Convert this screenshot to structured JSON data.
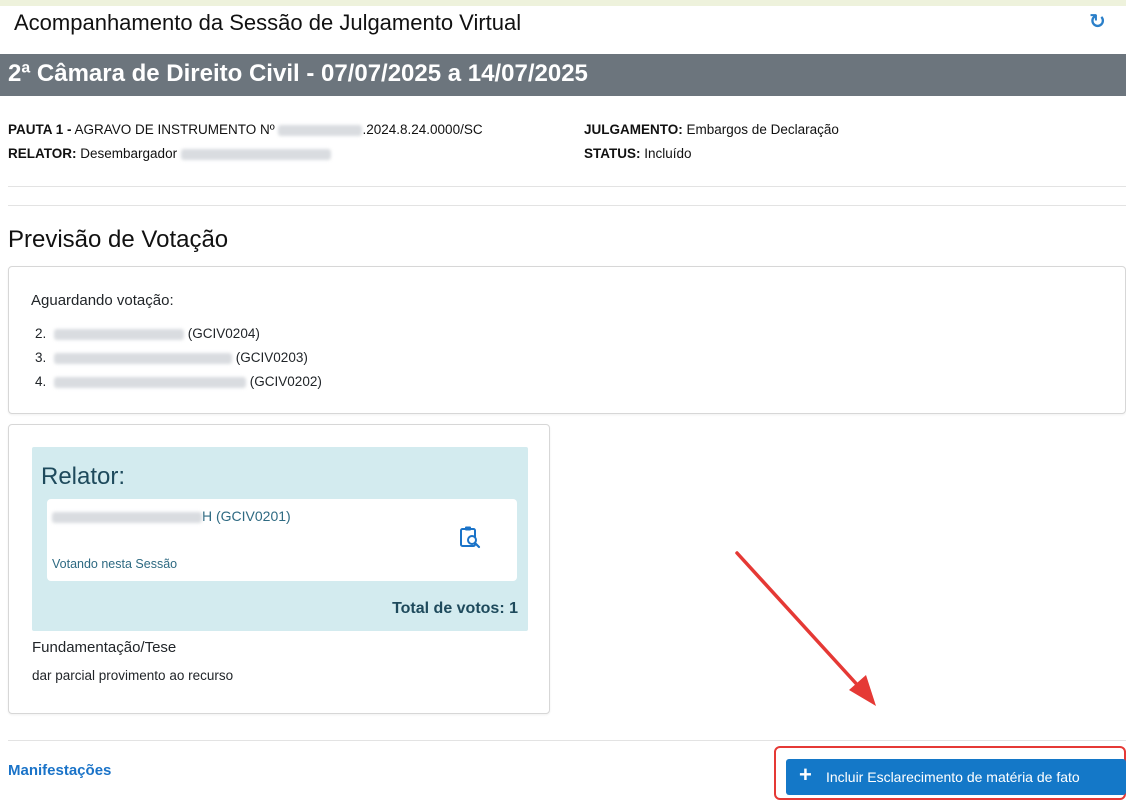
{
  "header": {
    "title": "Acompanhamento da Sessão de Julgamento Virtual",
    "refresh_icon": "refresh-icon"
  },
  "session_band": "2ª Câmara de Direito Civil - 07/07/2025 a 14/07/2025",
  "pauta": {
    "pauta_label": "PAUTA 1 -",
    "process_prefix": "AGRAVO DE INSTRUMENTO Nº",
    "process_suffix": ".2024.8.24.0000/SC",
    "relator_label": "RELATOR:",
    "relator_value": "Desembargador",
    "julgamento_label": "JULGAMENTO:",
    "julgamento_value": "Embargos de Declaração",
    "status_label": "STATUS:",
    "status_value": "Incluído"
  },
  "previsao": {
    "title": "Previsão de Votação",
    "awaiting_title": "Aguardando votação:",
    "awaiting": [
      {
        "num": "2.",
        "code": "(GCIV0204)"
      },
      {
        "num": "3.",
        "code": "(GCIV0203)"
      },
      {
        "num": "4.",
        "code": "(GCIV0202)"
      }
    ]
  },
  "relator_card": {
    "title": "Relator:",
    "name_suffix": "H (GCIV0201)",
    "status": "Votando nesta Sessão",
    "icon": "clipboard-search-icon",
    "total": "Total de votos: 1",
    "fundamentacao_title": "Fundamentação/Tese",
    "fundamentacao_text": "dar parcial provimento ao recurso"
  },
  "footer": {
    "manifestacoes": "Manifestações",
    "button_label": "Incluir Esclarecimento de matéria de fato"
  },
  "colors": {
    "band_bg": "#6c757d",
    "relator_bg": "#d3ebef",
    "primary": "#1478c8",
    "annotation": "#e53935"
  }
}
